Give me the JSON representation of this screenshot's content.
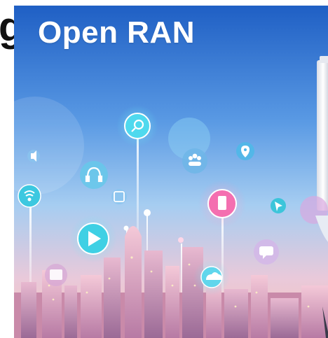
{
  "image": {
    "title": "Open RAN",
    "edge_text": "g",
    "icons": [
      "search-icon",
      "headphones-icon",
      "wifi-icon",
      "play-icon",
      "volume-icon",
      "users-icon",
      "location-pin-icon",
      "phone-icon",
      "cursor-icon",
      "chat-icon",
      "cloud-icon",
      "calendar-icon",
      "tablet-icon"
    ],
    "colors": {
      "sky_top": "#1f63c8",
      "sky_mid": "#7fb7ee",
      "horizon": "#f3c7d0",
      "glow_cyan": "#5ee6f2",
      "glow_pink": "#ff8fc0",
      "tower": "#f2f4f8"
    }
  }
}
